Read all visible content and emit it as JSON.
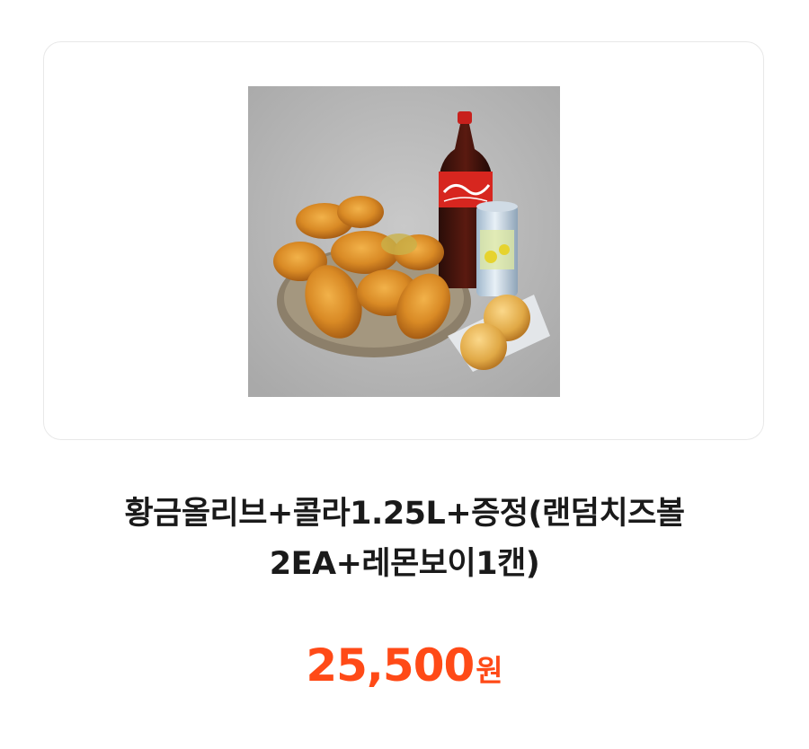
{
  "product": {
    "image_description_icon": "food-image",
    "title_line1": "황금올리브+콜라1.25L+증정(랜덤치즈볼",
    "title_line2": "2EA+레몬보이1캔)",
    "price_value": "25,500",
    "price_unit": "원"
  },
  "colors": {
    "price": "#ff4a17",
    "title": "#1a1a1a",
    "card_border": "#e8e8e8",
    "image_bg": "#b5b5b5"
  }
}
